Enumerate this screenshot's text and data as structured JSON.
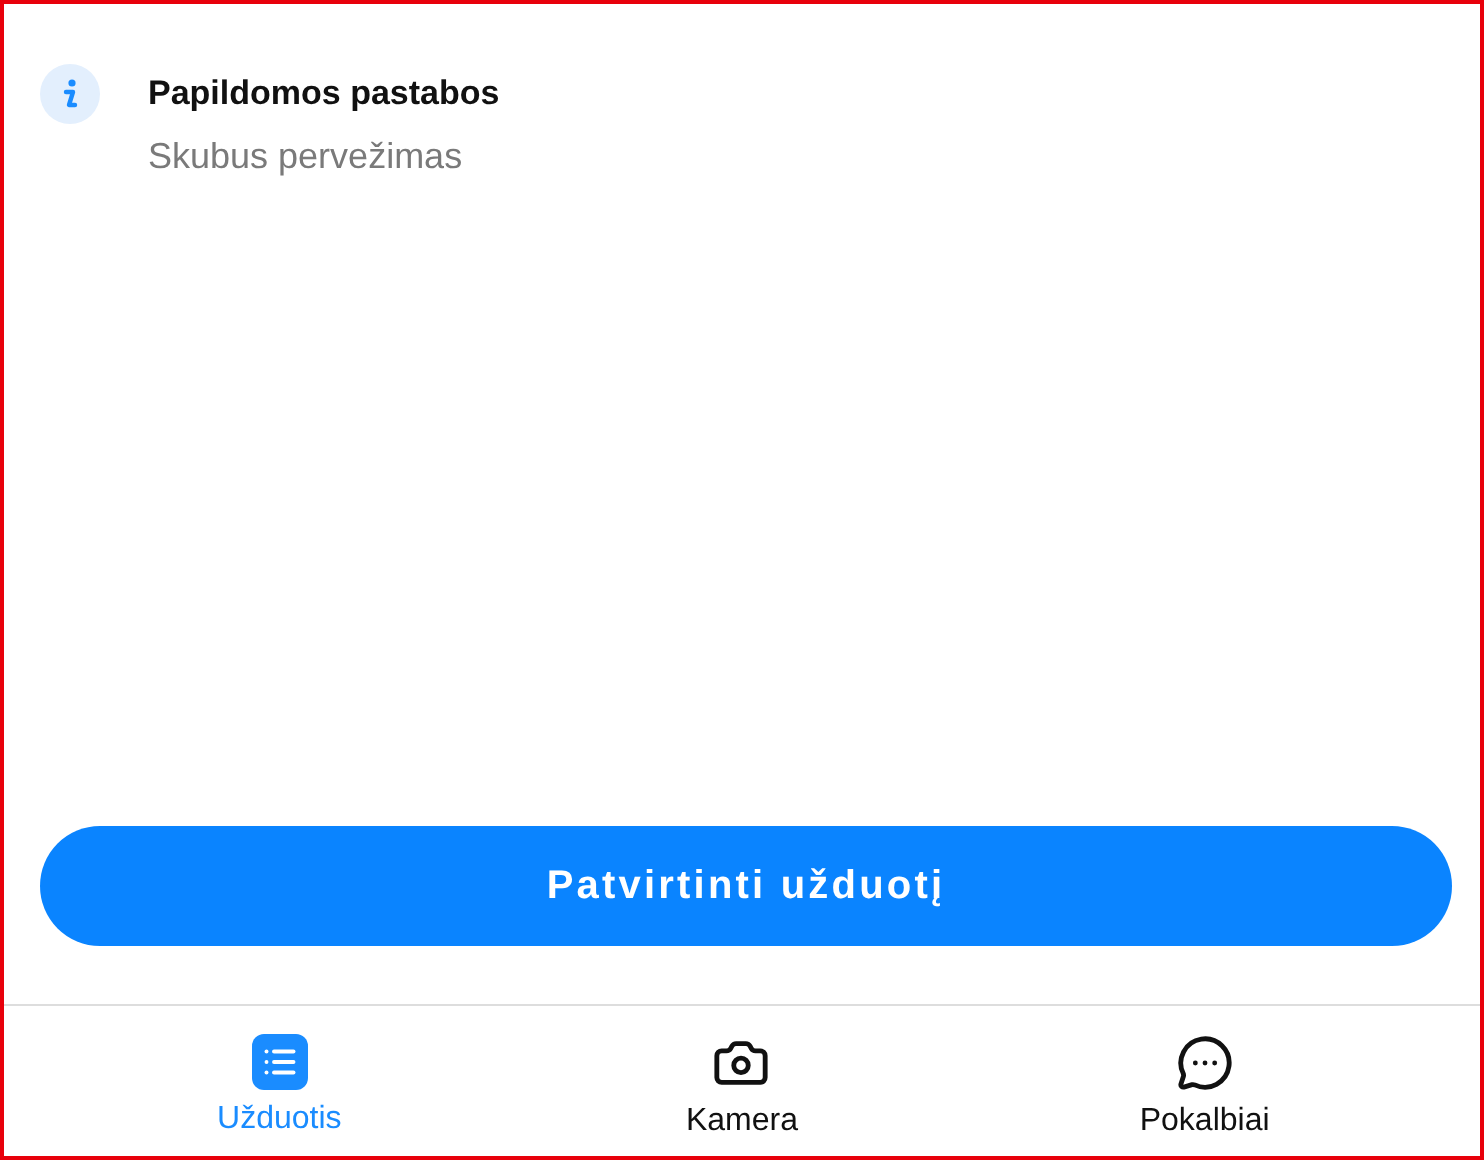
{
  "note": {
    "title": "Papildomos pastabos",
    "text": "Skubus pervežimas"
  },
  "confirm_button": {
    "label": "Patvirtinti užduotį"
  },
  "nav_tabs": [
    {
      "label": "Užduotis",
      "kind": "tasks",
      "selected": true
    },
    {
      "label": "Kamera",
      "kind": "camera",
      "selected": false
    },
    {
      "label": "Pokalbiai",
      "kind": "chat",
      "selected": false
    }
  ]
}
